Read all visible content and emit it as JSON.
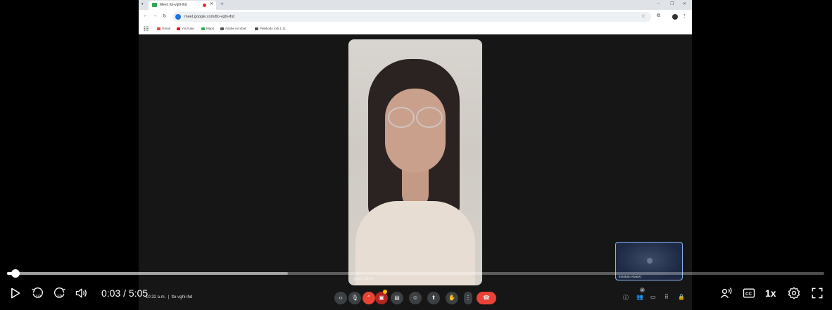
{
  "browser": {
    "tab_title": "Meet: tto-vghi-lhd",
    "url": "meet.google.com/tto-vghi-lhd",
    "bookmarks": [
      {
        "label": "Gmail",
        "color": "#ea4335"
      },
      {
        "label": "YouTube",
        "color": "#ff0000"
      },
      {
        "label": "Maps",
        "color": "#34a853"
      },
      {
        "label": "Adobe Acrobat",
        "color": "#555555"
      },
      {
        "label": "Pelekodo v25.1.11",
        "color": "#555555"
      }
    ]
  },
  "meet": {
    "participant_name": "yuu1 (ldle)",
    "self_view_name": "Esteban Alvarez",
    "clock": "10:32 a.m.",
    "meeting_code": "tto-vghi-lhd",
    "people_count": "2"
  },
  "player": {
    "current_time": "0:03",
    "separator": " / ",
    "duration": "5:05",
    "progress_fraction": 0.0099,
    "buffered_fraction": 0.344,
    "speed": "1x",
    "accent": "#ffffff"
  },
  "icons": {
    "play": "play-icon",
    "rewind": "rewind-10-icon",
    "forward": "forward-10-icon",
    "volume": "volume-icon",
    "audio_description": "audio-description-icon",
    "captions": "closed-captions-icon",
    "settings": "gear-icon",
    "fullscreen": "fullscreen-icon"
  }
}
